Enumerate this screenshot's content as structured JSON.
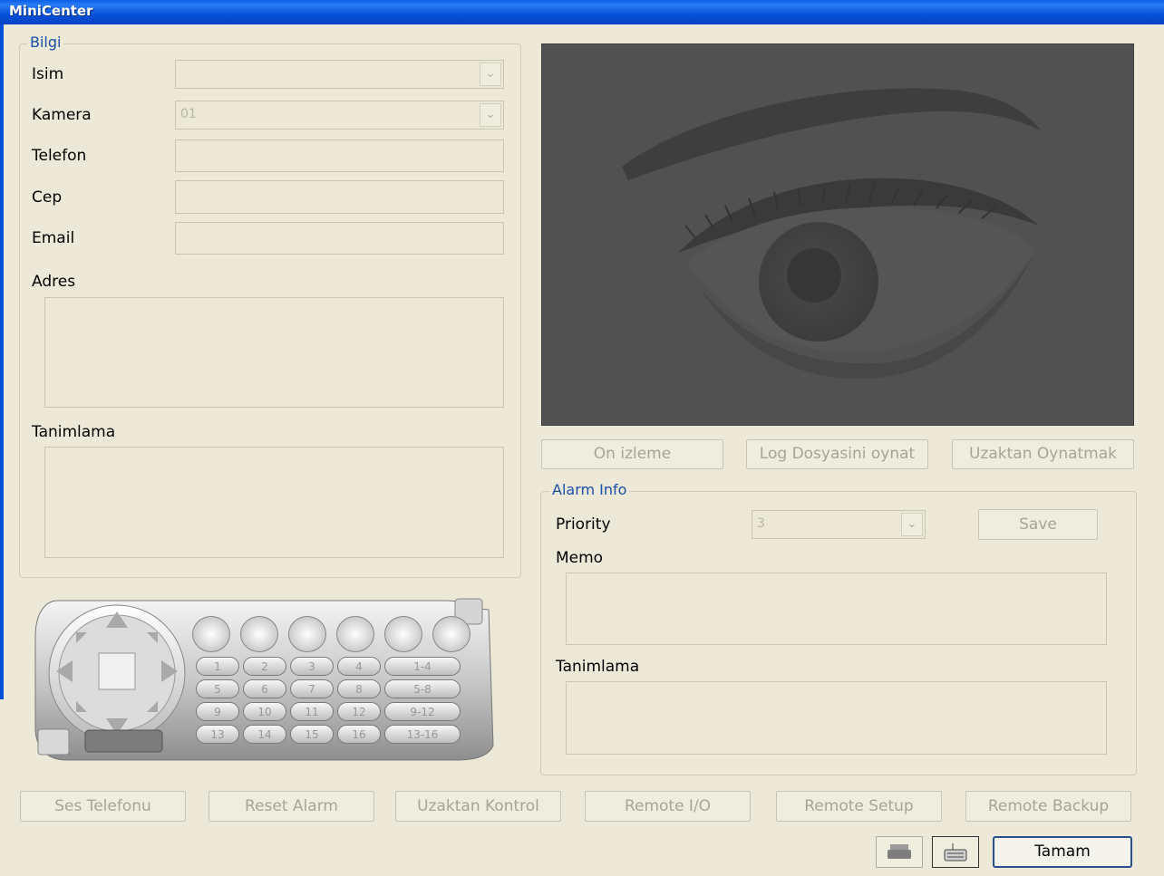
{
  "window": {
    "title": "MiniCenter"
  },
  "bilgi": {
    "legend": "Bilgi",
    "isim_label": "Isim",
    "isim_value": "",
    "kamera_label": "Kamera",
    "kamera_value": "01",
    "telefon_label": "Telefon",
    "cep_label": "Cep",
    "email_label": "Email",
    "adres_label": "Adres",
    "tanimlama_label": "Tanimlama"
  },
  "video_buttons": {
    "preview": "On izleme",
    "log": "Log Dosyasini oynat",
    "remote_play": "Uzaktan Oynatmak"
  },
  "alarm": {
    "legend": "Alarm Info",
    "priority_label": "Priority",
    "priority_value": "3",
    "save_label": "Save",
    "memo_label": "Memo",
    "tanimlama_label": "Tanimlama"
  },
  "ptz": {
    "presets": [
      "1",
      "2",
      "3",
      "4",
      "1-4",
      "5",
      "6",
      "7",
      "8",
      "5-8",
      "9",
      "10",
      "11",
      "12",
      "9-12",
      "13",
      "14",
      "15",
      "16",
      "13-16"
    ]
  },
  "bottom_buttons": {
    "ses": "Ses Telefonu",
    "reset": "Reset Alarm",
    "kontrol": "Uzaktan Kontrol",
    "io": "Remote I/O",
    "setup": "Remote Setup",
    "backup": "Remote Backup"
  },
  "footer": {
    "ok_label": "Tamam"
  },
  "icons": {
    "print": "print-icon",
    "keyboard": "keyboard-icon"
  }
}
